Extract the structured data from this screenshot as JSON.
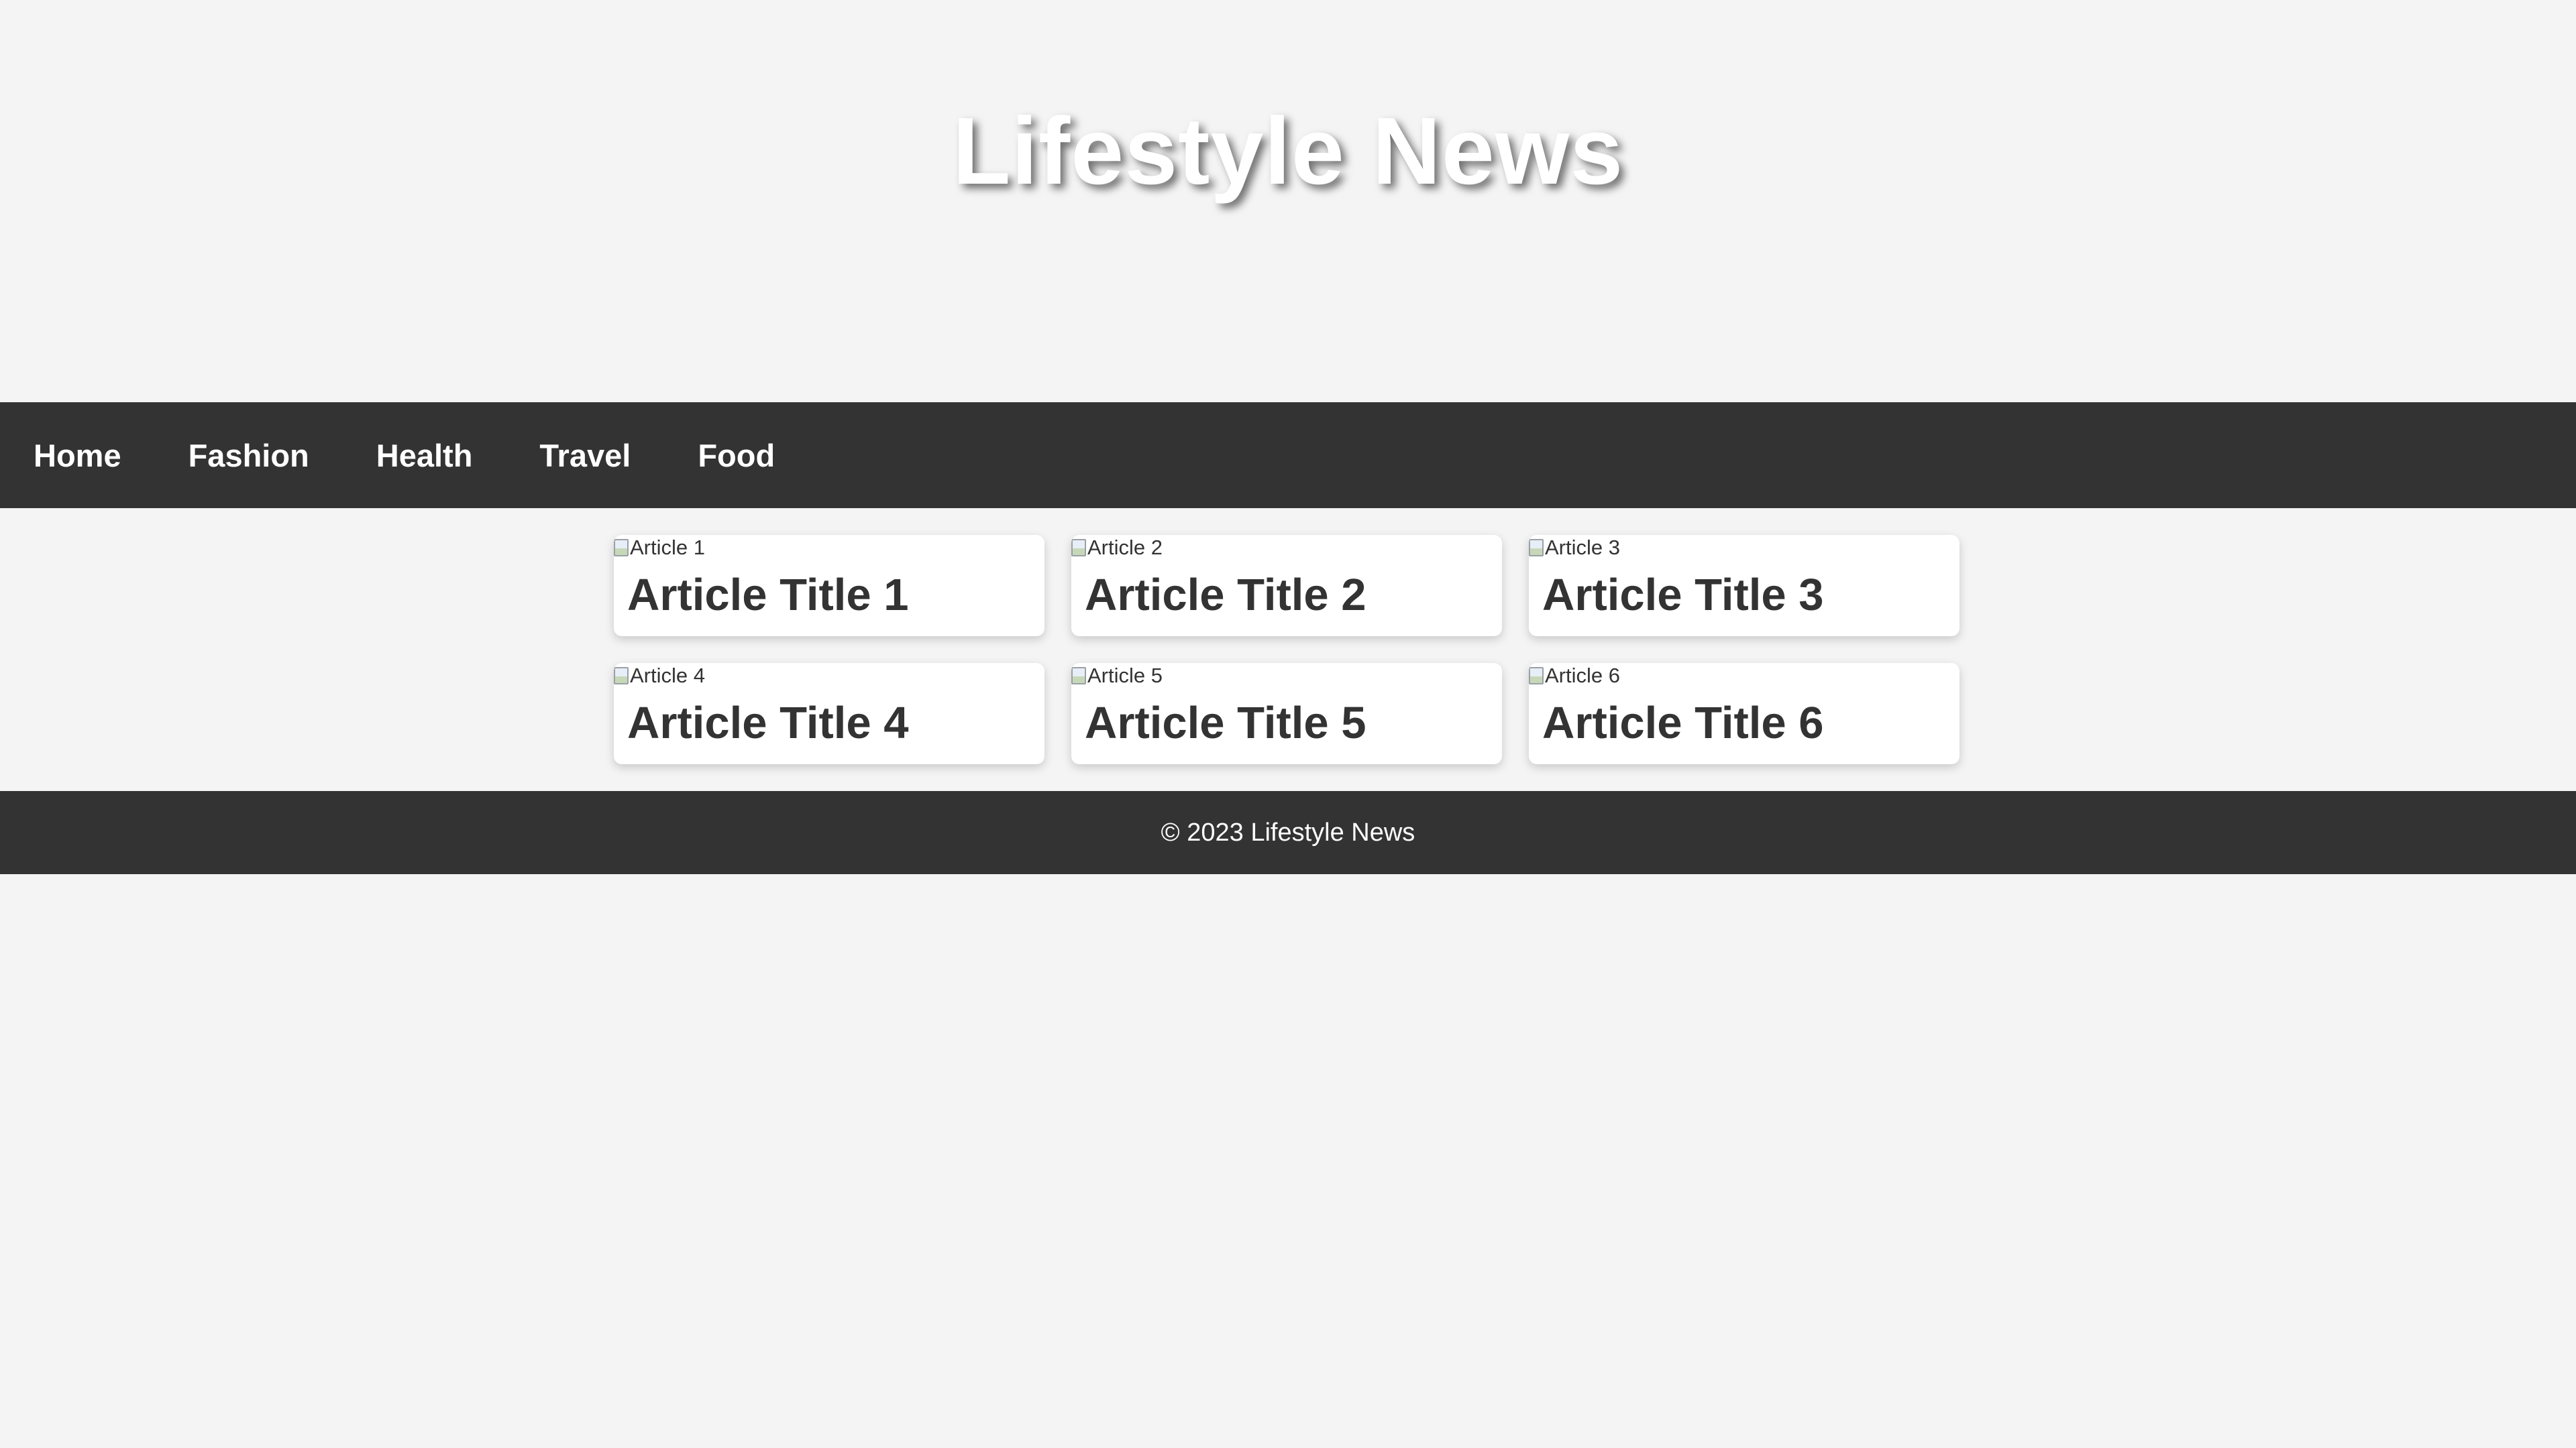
{
  "header": {
    "title": "Lifestyle News"
  },
  "nav": {
    "items": [
      {
        "label": "Home"
      },
      {
        "label": "Fashion"
      },
      {
        "label": "Health"
      },
      {
        "label": "Travel"
      },
      {
        "label": "Food"
      }
    ]
  },
  "articles": [
    {
      "image_alt": "Article 1",
      "title": "Article Title 1"
    },
    {
      "image_alt": "Article 2",
      "title": "Article Title 2"
    },
    {
      "image_alt": "Article 3",
      "title": "Article Title 3"
    },
    {
      "image_alt": "Article 4",
      "title": "Article Title 4"
    },
    {
      "image_alt": "Article 5",
      "title": "Article Title 5"
    },
    {
      "image_alt": "Article 6",
      "title": "Article Title 6"
    }
  ],
  "footer": {
    "text": "© 2023 Lifestyle News"
  },
  "colors": {
    "background": "#f4f4f4",
    "nav_background": "#333333",
    "card_background": "#ffffff",
    "title_text": "#333333"
  }
}
